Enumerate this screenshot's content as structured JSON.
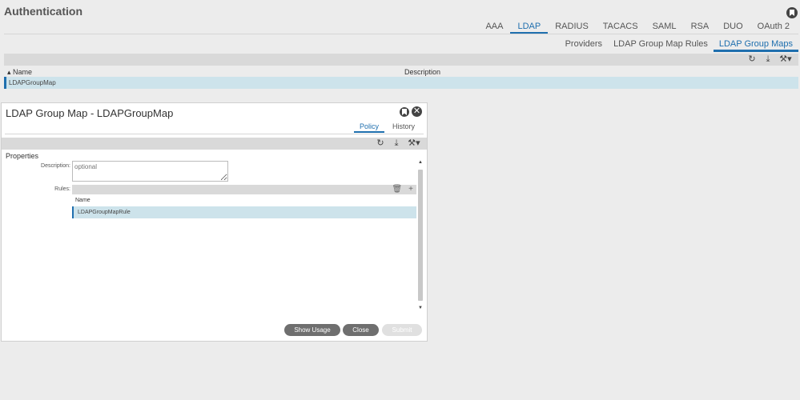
{
  "app": {
    "title": "Authentication"
  },
  "tabs": [
    "AAA",
    "LDAP",
    "RADIUS",
    "TACACS",
    "SAML",
    "RSA",
    "DUO",
    "OAuth 2"
  ],
  "active_tab": "LDAP",
  "subtabs": [
    "Providers",
    "LDAP Group Map Rules",
    "LDAP Group Maps"
  ],
  "active_subtab": "LDAP Group Maps",
  "table": {
    "columns": {
      "name": "Name",
      "description": "Description"
    },
    "rows": [
      {
        "name": "LDAPGroupMap",
        "description": ""
      }
    ]
  },
  "dialog": {
    "title": "LDAP Group Map - LDAPGroupMap",
    "tabs": {
      "policy": "Policy",
      "history": "History"
    },
    "properties_label": "Properties",
    "description_label": "Description:",
    "description_placeholder": "optional",
    "rules_label": "Rules:",
    "rules_col_name": "Name",
    "rules_rows": [
      "LDAPGroupMapRule"
    ],
    "buttons": {
      "show_usage": "Show Usage",
      "close": "Close",
      "submit": "Submit"
    }
  },
  "icons": {
    "refresh": "refresh-icon",
    "download": "download-icon",
    "tools": "tools-icon",
    "trash": "trash-icon",
    "add": "plus-icon",
    "close": "close-icon",
    "bookmark": "bookmark-icon"
  },
  "colors": {
    "accent": "#1f6fae",
    "selected_row": "#cde3eb",
    "toolbar": "#d9d9d9"
  }
}
